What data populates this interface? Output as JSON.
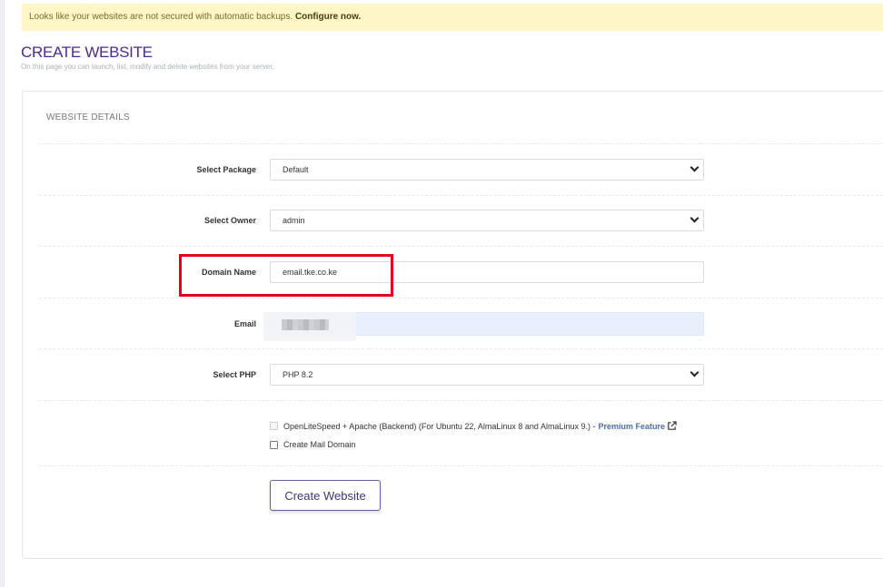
{
  "notice": {
    "text": "Looks like your websites are not secured with automatic backups. ",
    "link": "Configure now."
  },
  "header": {
    "title": "CREATE WEBSITE",
    "subtitle": "On this page you can launch, list, modify and delete websites from your server."
  },
  "card": {
    "title": "WEBSITE DETAILS"
  },
  "form": {
    "package": {
      "label": "Select Package",
      "value": "Default"
    },
    "owner": {
      "label": "Select Owner",
      "value": "admin"
    },
    "domain": {
      "label": "Domain Name",
      "value": "email.tke.co.ke"
    },
    "email": {
      "label": "Email",
      "value": ""
    },
    "php": {
      "label": "Select PHP",
      "value": "PHP 8.2"
    },
    "ols_option": {
      "text": "OpenLiteSpeed + Apache (Backend) (For Ubuntu 22, AlmaLinux 8 and AlmaLinux 9.) -",
      "link": "Premium Feature"
    },
    "mail_domain": {
      "label": "Create Mail Domain"
    }
  },
  "actions": {
    "create_label": "Create Website"
  },
  "icons": {
    "select_arrow": "chevron-down-icon",
    "external_link": "external-link-icon"
  },
  "colors": {
    "title": "#4f2a8a",
    "highlight": "#e3001b",
    "notice_bg": "#fdf6c6",
    "premium_link": "#4b6ea8"
  }
}
